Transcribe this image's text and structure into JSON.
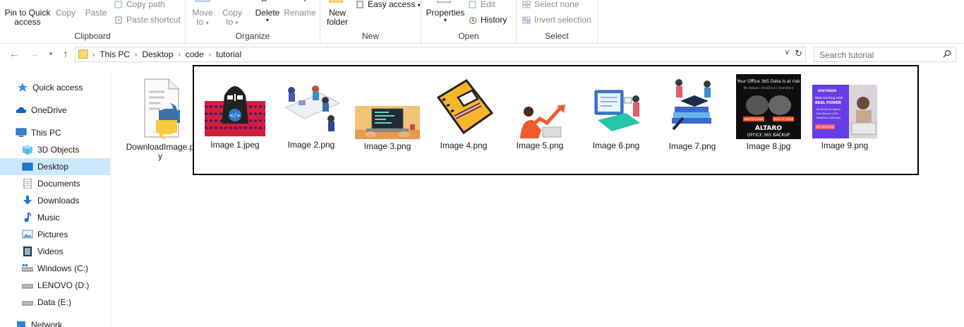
{
  "ribbon": {
    "pin_line1": "Pin to Quick",
    "pin_line2": "access",
    "copy": "Copy",
    "paste": "Paste",
    "copy_path": "Copy path",
    "paste_shortcut": "Paste shortcut",
    "clipboard_label": "Clipboard",
    "move_to_1": "Move",
    "move_to_2": "to",
    "copy_to_1": "Copy",
    "copy_to_2": "to",
    "delete": "Delete",
    "rename": "Rename",
    "organize_label": "Organize",
    "new_folder_1": "New",
    "new_folder_2": "folder",
    "easy_access": "Easy access",
    "new_label": "New",
    "properties": "Properties",
    "edit": "Edit",
    "history": "History",
    "open_label": "Open",
    "select_none": "Select none",
    "invert_selection": "Invert selection",
    "select_label": "Select"
  },
  "address": {
    "crumbs": [
      "This PC",
      "Desktop",
      "code",
      "tutorial"
    ],
    "search_placeholder": "Search tutorial"
  },
  "sidebar": {
    "items": [
      {
        "label": "Quick access",
        "icon": "star-icon"
      },
      {
        "label": "OneDrive",
        "icon": "cloud-icon"
      },
      {
        "label": "This PC",
        "icon": "computer-icon"
      },
      {
        "label": "3D Objects",
        "icon": "cube-icon"
      },
      {
        "label": "Desktop",
        "icon": "desktop-icon"
      },
      {
        "label": "Documents",
        "icon": "document-icon"
      },
      {
        "label": "Downloads",
        "icon": "download-icon"
      },
      {
        "label": "Music",
        "icon": "music-icon"
      },
      {
        "label": "Pictures",
        "icon": "picture-icon"
      },
      {
        "label": "Videos",
        "icon": "video-icon"
      },
      {
        "label": "Windows (C:)",
        "icon": "drive-icon"
      },
      {
        "label": "LENOVO (D:)",
        "icon": "drive-icon"
      },
      {
        "label": "Data (E:)",
        "icon": "drive-icon"
      },
      {
        "label": "Network",
        "icon": "network-icon"
      }
    ]
  },
  "files": [
    {
      "label": "DownloadImage.py",
      "type": "python"
    },
    {
      "label": "Image 1.jpeg"
    },
    {
      "label": "Image 2.png"
    },
    {
      "label": "Image 3.png"
    },
    {
      "label": "Image 4.png"
    },
    {
      "label": "Image 5.png"
    },
    {
      "label": "Image 6.png"
    },
    {
      "label": "Image 7.png"
    },
    {
      "label": "Image 8.jpg"
    },
    {
      "label": "Image 9.png"
    }
  ],
  "thumb_text": {
    "office_headline": "Your Office 365 Data is at risk",
    "office_sub": "My Inboxes | OneDrive | SharePoint",
    "office_btn1": "KEEP KNOWING",
    "office_btn2": "MADE OF SAFER",
    "office_brand": "ALTARO",
    "office_product": "OFFICE 365 BACKUP",
    "host_brand": "HOSTINGER",
    "host_line1": "Web Hosting with",
    "host_line2": "REAL POWER",
    "host_bullets": [
      "99.9% Server Uptime",
      "Free Domain & SSL",
      "WordPress Optimized"
    ],
    "host_btn": "GET DEAL NOW"
  },
  "colors": {
    "selected_bg": "#cce8ff",
    "highlight_border": "#000000",
    "folder_yellow": "#f8d775"
  }
}
